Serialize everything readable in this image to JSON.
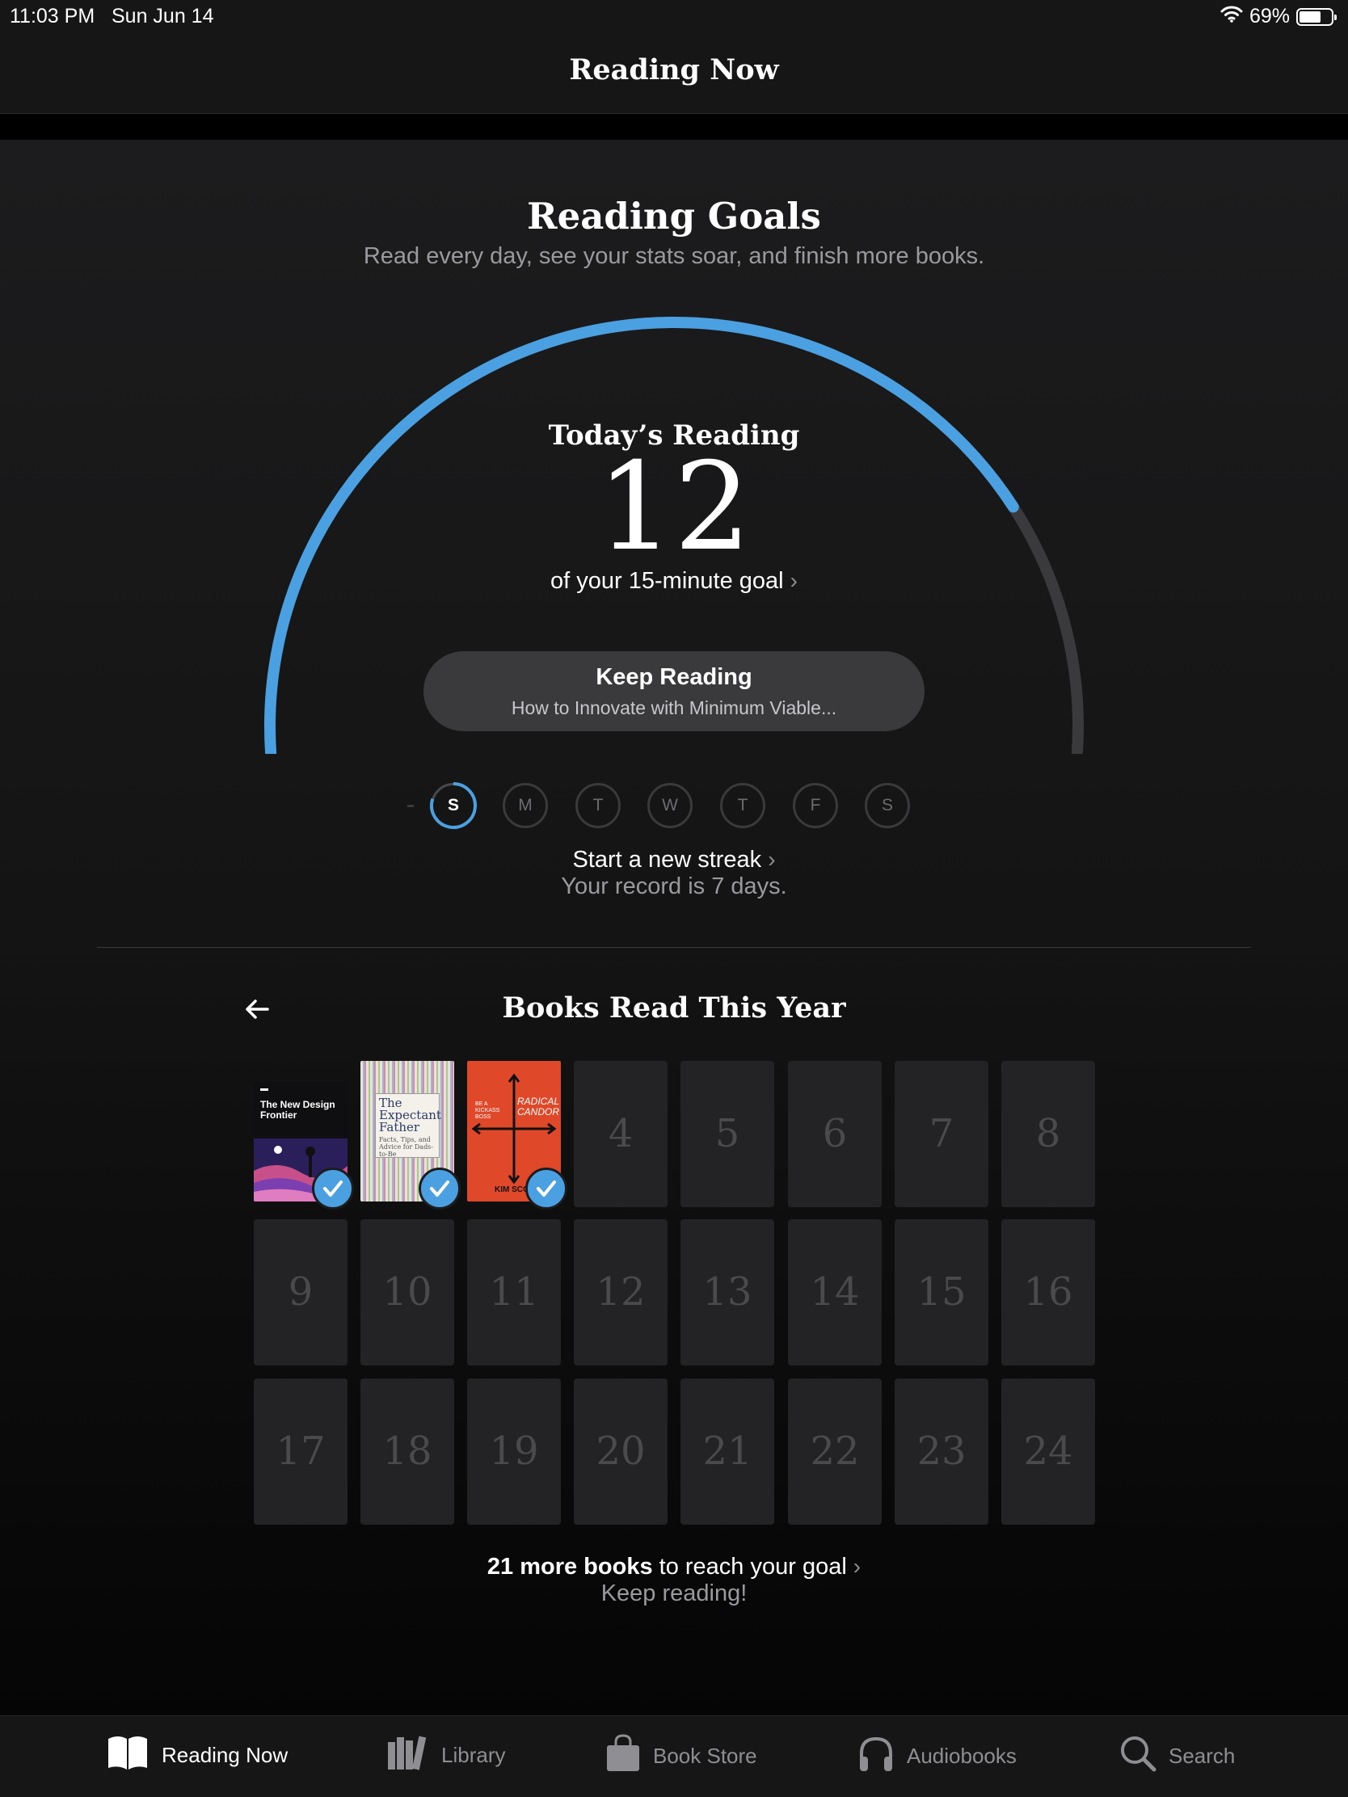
{
  "status_bar": {
    "time": "11:03 PM",
    "date": "Sun Jun 14",
    "battery": "69%",
    "battery_level": 0.69
  },
  "nav": {
    "title": "Reading Now"
  },
  "goals": {
    "title": "Reading Goals",
    "subtitle": "Read every day, see your stats soar, and finish more books.",
    "today_label": "Today’s Reading",
    "today_minutes": "12",
    "goal_text": "of your 15-minute goal",
    "progress": 0.8,
    "keep_reading": {
      "label": "Keep Reading",
      "book": "How to Innovate with Minimum Viable..."
    },
    "days": [
      "S",
      "M",
      "T",
      "W",
      "T",
      "F",
      "S"
    ],
    "streak_title": "Start a new streak",
    "streak_record": "Your record is 7 days."
  },
  "books_year": {
    "title": "Books Read This Year",
    "read_books": [
      {
        "title": "The New Design Frontier"
      },
      {
        "title": "The Expectant Father",
        "subtitle": "Facts, Tips, and Advice for Dads-to-Be"
      },
      {
        "title": "RADICAL CANDOR",
        "tagline": "BE A KICKASS BOSS",
        "author": "KIM SCOTT"
      }
    ],
    "slots": [
      "4",
      "5",
      "6",
      "7",
      "8",
      "9",
      "10",
      "11",
      "12",
      "13",
      "14",
      "15",
      "16",
      "17",
      "18",
      "19",
      "20",
      "21",
      "22",
      "23",
      "24"
    ],
    "remaining_bold": "21 more books",
    "remaining_rest": " to reach your goal",
    "encouragement": "Keep reading!"
  },
  "tabs": [
    {
      "label": "Reading Now",
      "icon": "book-open-icon",
      "active": true
    },
    {
      "label": "Library",
      "icon": "library-icon"
    },
    {
      "label": "Book Store",
      "icon": "bag-icon"
    },
    {
      "label": "Audiobooks",
      "icon": "headphones-icon"
    },
    {
      "label": "Search",
      "icon": "search-icon"
    }
  ],
  "colors": {
    "accent": "#4aa0e0",
    "track": "#3a3a3c",
    "background": "#000000"
  }
}
